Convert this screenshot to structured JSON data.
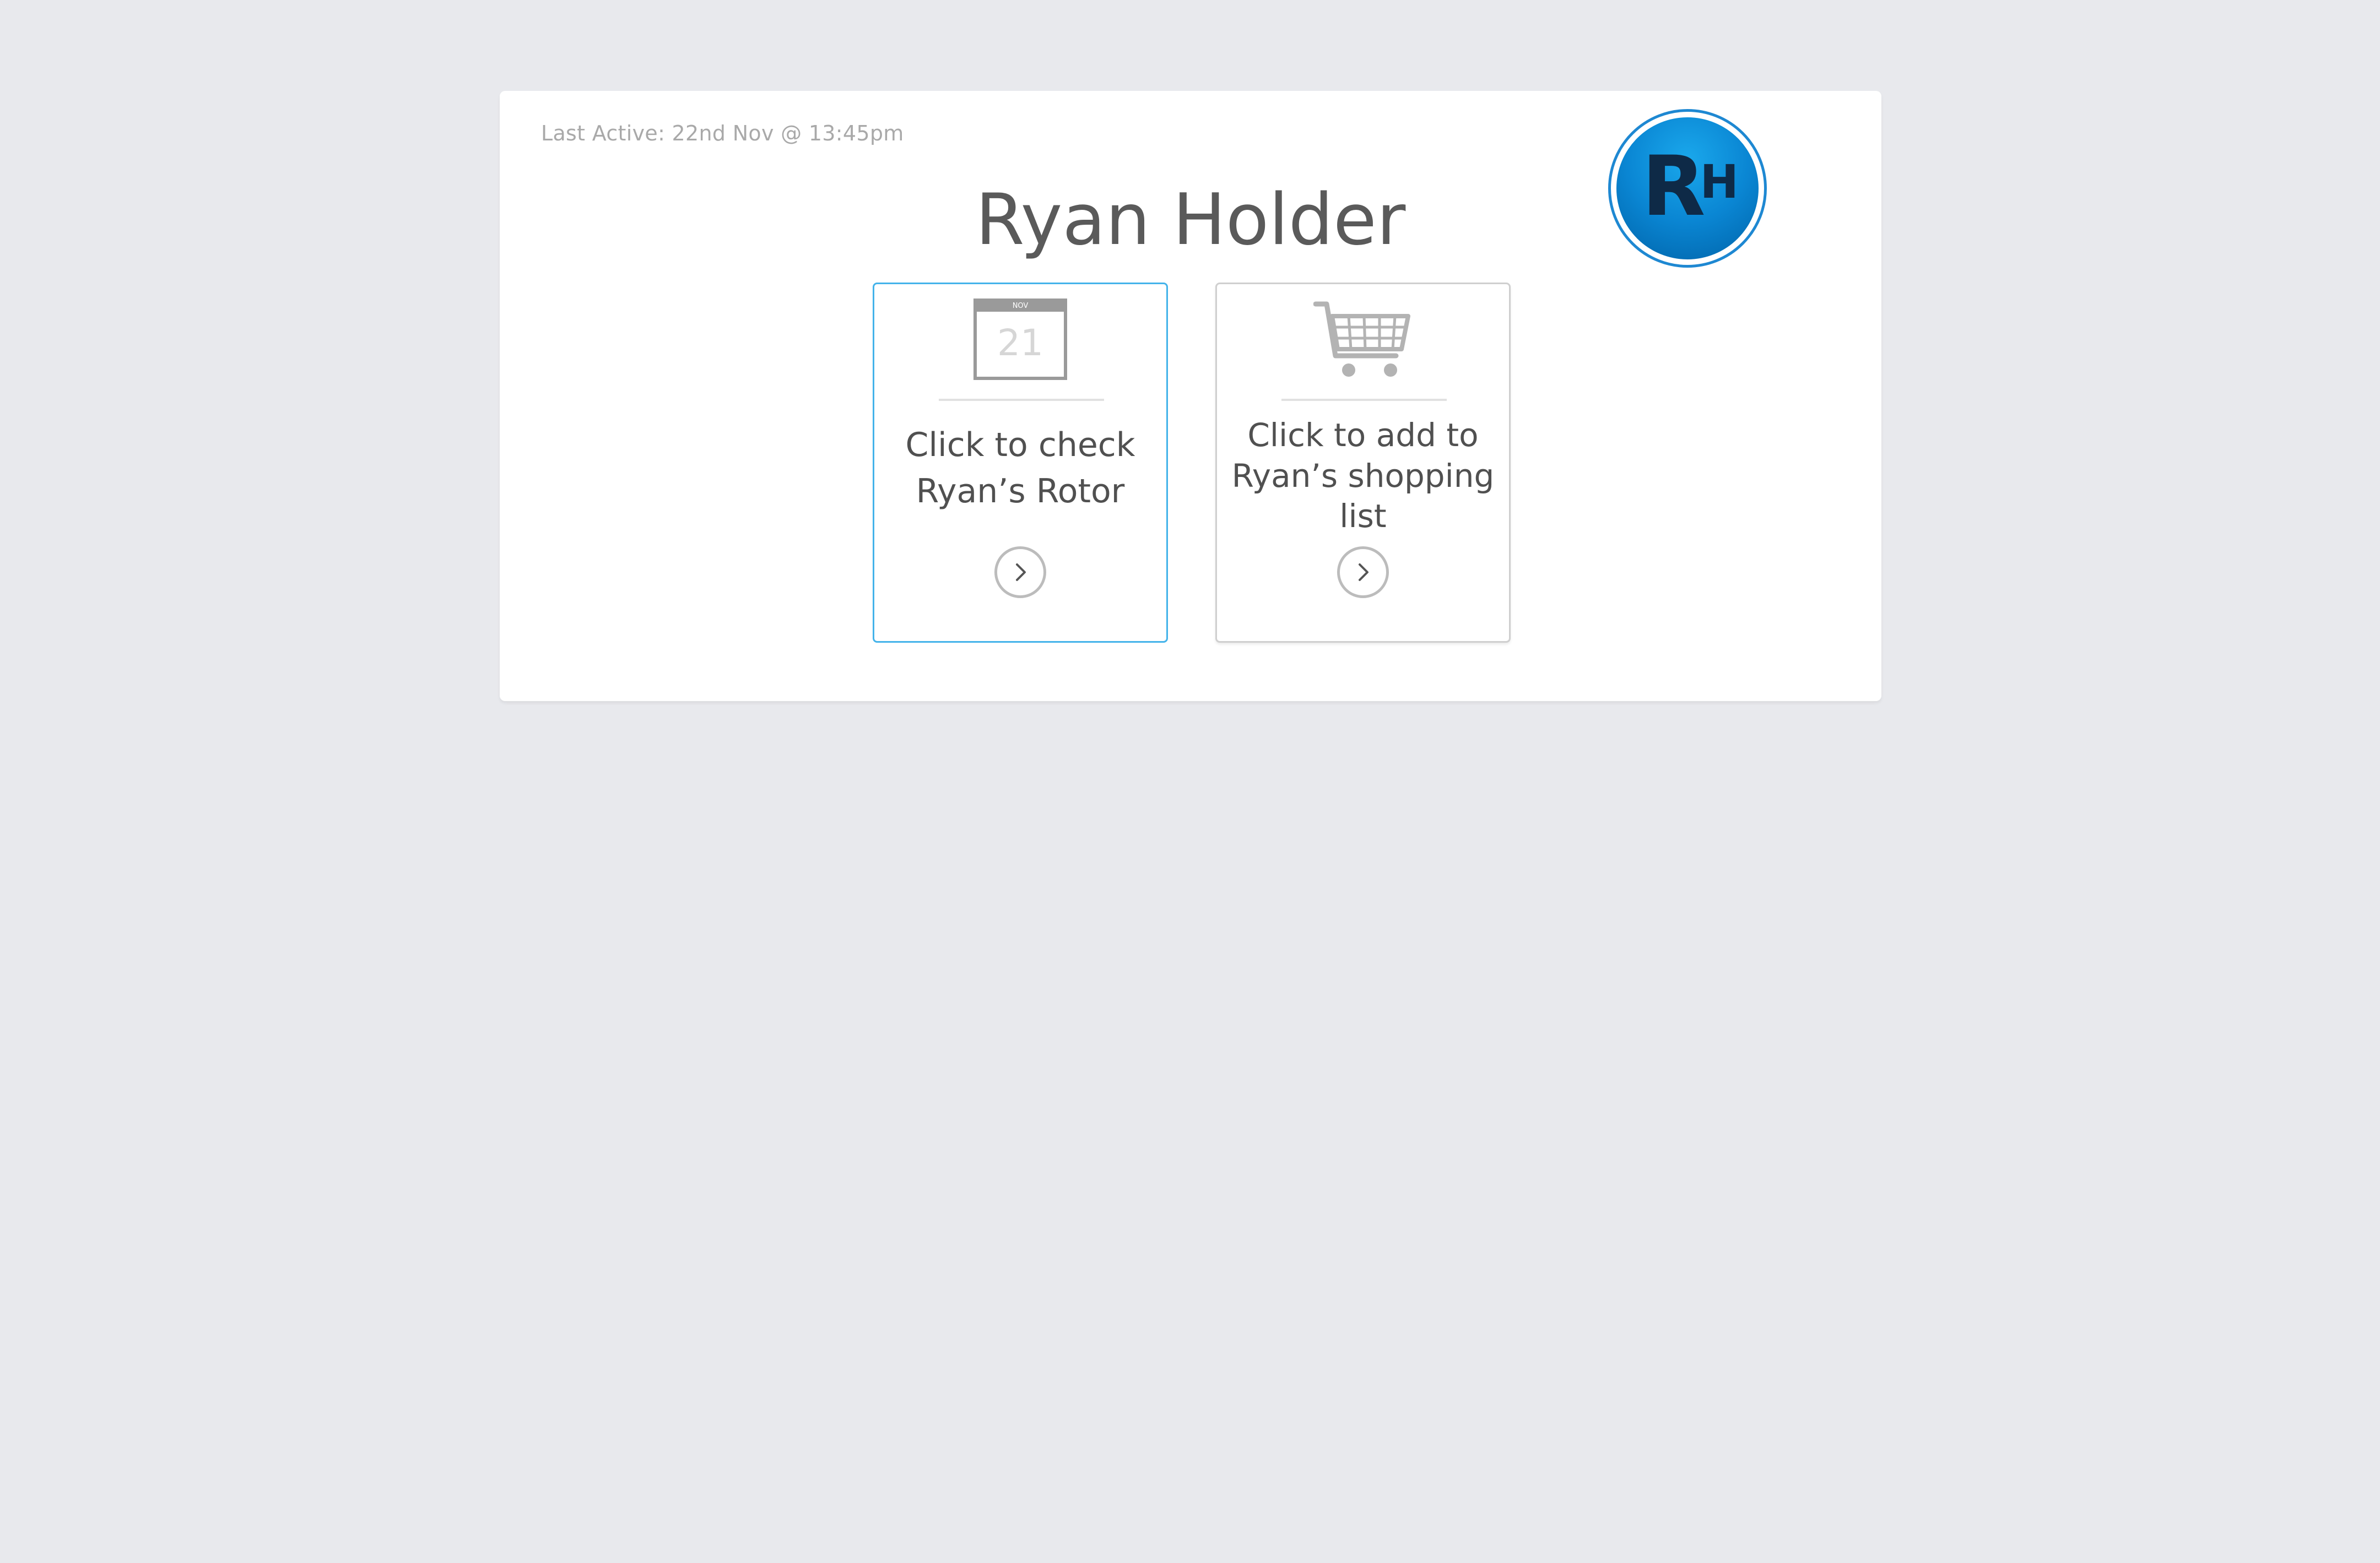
{
  "profile": {
    "last_active": "Last Active: 22nd Nov @ 13:45pm",
    "initials_first": "R",
    "initials_last": "H",
    "name": "Ryan Holder"
  },
  "tiles": [
    {
      "icon": "calendar-icon",
      "calendar_month": "NOV",
      "calendar_day": "21",
      "text": "Click to check Ryan’s Rotor",
      "active": true
    },
    {
      "icon": "shopping-cart-icon",
      "text": "Click to add to Ryan’s shopping list",
      "active": false
    }
  ],
  "colors": {
    "background": "#e8e9ed",
    "accent": "#44b3ea",
    "avatar": "#0a86d3",
    "text": "#505050"
  }
}
